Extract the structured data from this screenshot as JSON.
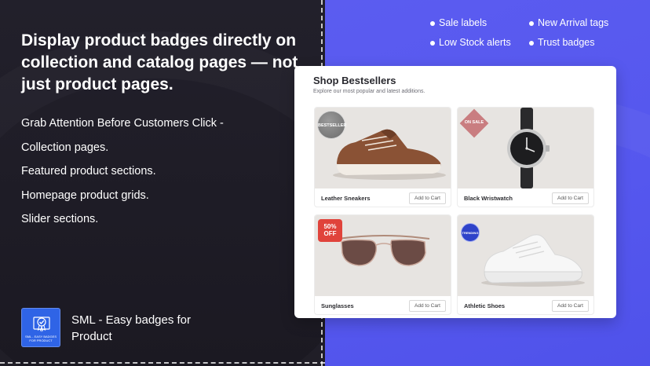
{
  "left_panel": {
    "headline": "Display product badges directly on collection and catalog pages — not just product pages.",
    "features": [
      "Grab Attention Before Customers Click -",
      "Collection pages.",
      "Featured product sections.",
      "Homepage product grids.",
      "Slider sections."
    ],
    "app": {
      "name": "SML - Easy badges for Product",
      "icon_caption": "SML - EASY BADGES FOR PRODUCT"
    }
  },
  "right_panel": {
    "bullets": [
      "Sale labels",
      "New Arrival tags",
      "Low Stock alerts",
      "Trust badges"
    ],
    "store": {
      "title": "Shop Bestsellers",
      "subtitle": "Explore our most popular and latest additions.",
      "products": [
        {
          "name": "Leather Sneakers",
          "cart_label": "Add to Cart",
          "badge": "BESTSELLER",
          "image": "brown-sneaker"
        },
        {
          "name": "Black Wristwatch",
          "cart_label": "Add to Cart",
          "badge": "ON SALE",
          "image": "wristwatch"
        },
        {
          "name": "Sunglasses",
          "cart_label": "Add to Cart",
          "badge": "50% OFF",
          "image": "sunglasses"
        },
        {
          "name": "Athletic Shoes",
          "cart_label": "Add to Cart",
          "badge": "TRENDING",
          "image": "white-sneaker"
        }
      ]
    }
  },
  "colors": {
    "left_bg": "#1c1a24",
    "right_bg": "#5557ee",
    "sale_red": "#e0433b",
    "trend_blue": "#2f43c9",
    "onsale_pink": "#c97d80"
  }
}
